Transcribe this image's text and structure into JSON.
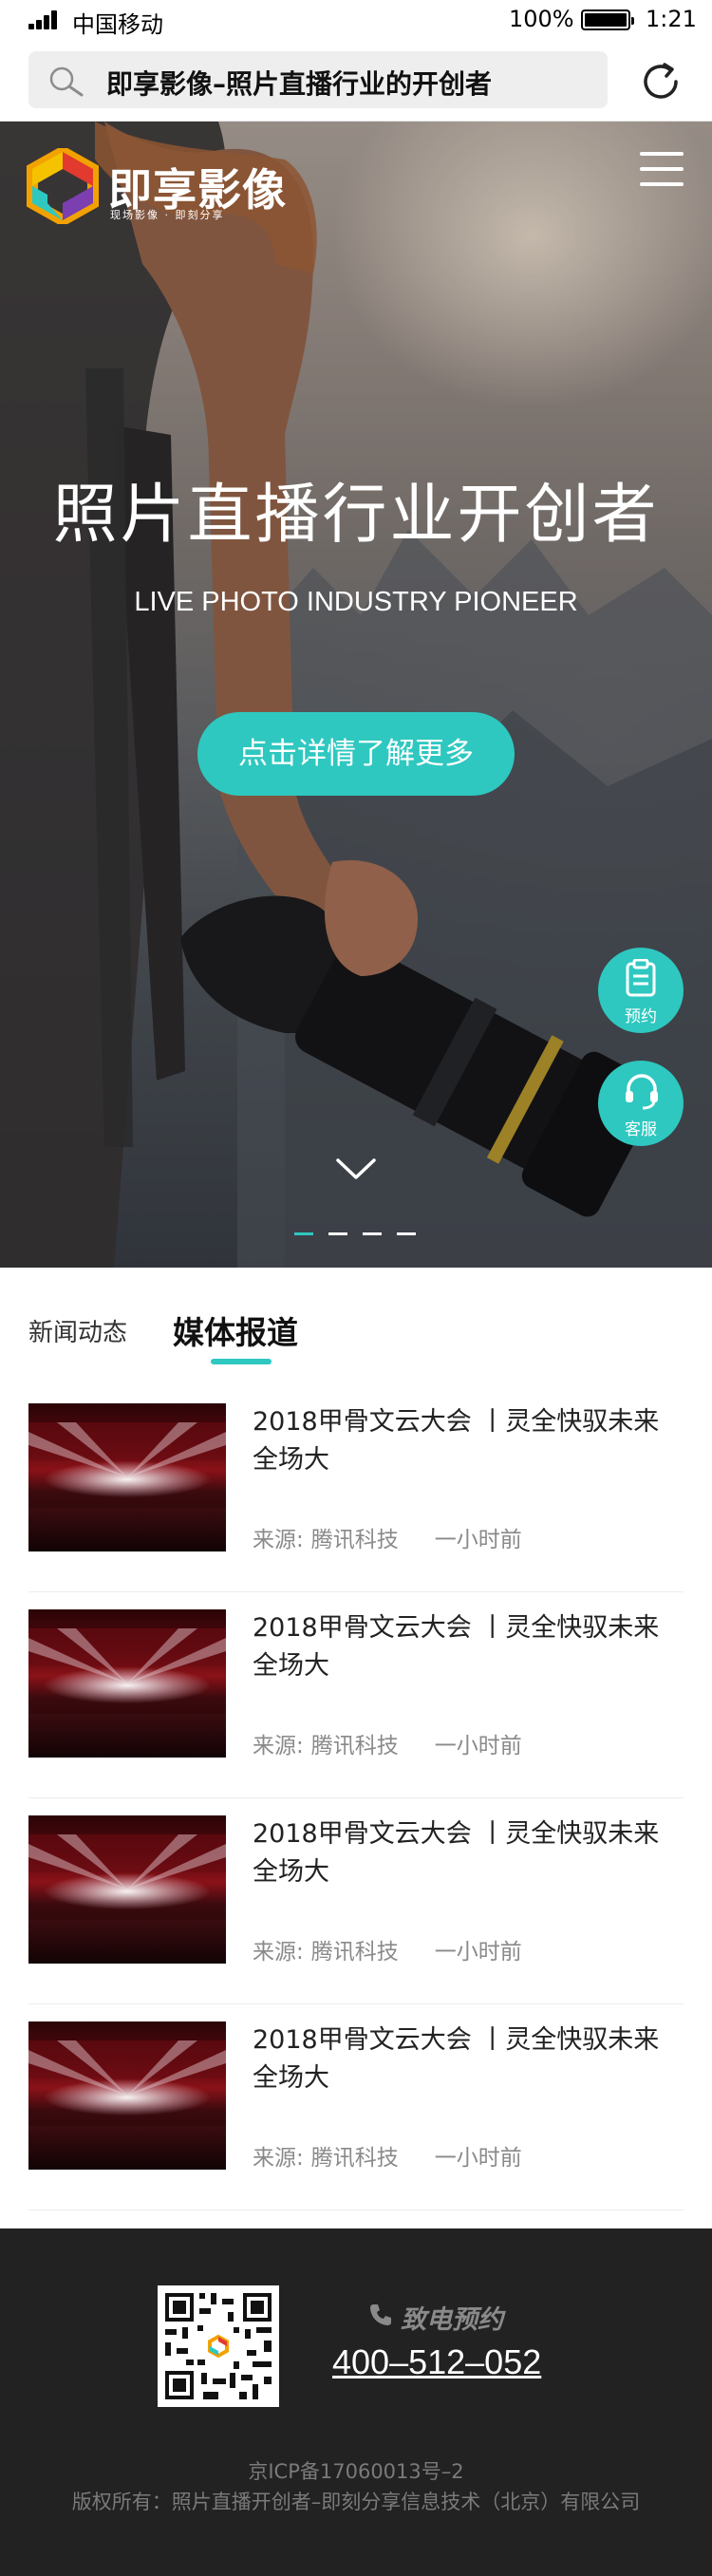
{
  "status_bar": {
    "carrier": "中国移动",
    "battery": "100%",
    "time": "1:21"
  },
  "browser": {
    "url_title": "即享影像–照片直播行业的开创者"
  },
  "header": {
    "logo_name": "即享影像",
    "logo_tagline": "现场影像 · 即刻分享"
  },
  "hero": {
    "title": "照片直播行业开创者",
    "subtitle": "LIVE PHOTO INDUSTRY PIONEER",
    "cta": "点击详情了解更多",
    "slides_total": 4,
    "slide_active": 1
  },
  "float_actions": {
    "book": "预约",
    "service": "客服"
  },
  "tabs": {
    "news": "新闻动态",
    "media": "媒体报道",
    "active": "media"
  },
  "news": [
    {
      "title": "2018甲骨文云大会 丨灵全快驭未来全场大",
      "source_label": "来源:",
      "source": "腾讯科技",
      "time": "一小时前"
    },
    {
      "title": "2018甲骨文云大会 丨灵全快驭未来全场大",
      "source_label": "来源:",
      "source": "腾讯科技",
      "time": "一小时前"
    },
    {
      "title": "2018甲骨文云大会 丨灵全快驭未来全场大",
      "source_label": "来源:",
      "source": "腾讯科技",
      "time": "一小时前"
    },
    {
      "title": "2018甲骨文云大会 丨灵全快驭未来全场大",
      "source_label": "来源:",
      "source": "腾讯科技",
      "time": "一小时前"
    }
  ],
  "footer": {
    "phone_label": "致电预约",
    "phone": "400–512–052",
    "icp": "京ICP备17060013号–2",
    "copyright": "版权所有：照片直播开创者–即刻分享信息技术（北京）有限公司"
  },
  "colors": {
    "accent": "#2ec8c0",
    "footer_bg": "#222222"
  }
}
